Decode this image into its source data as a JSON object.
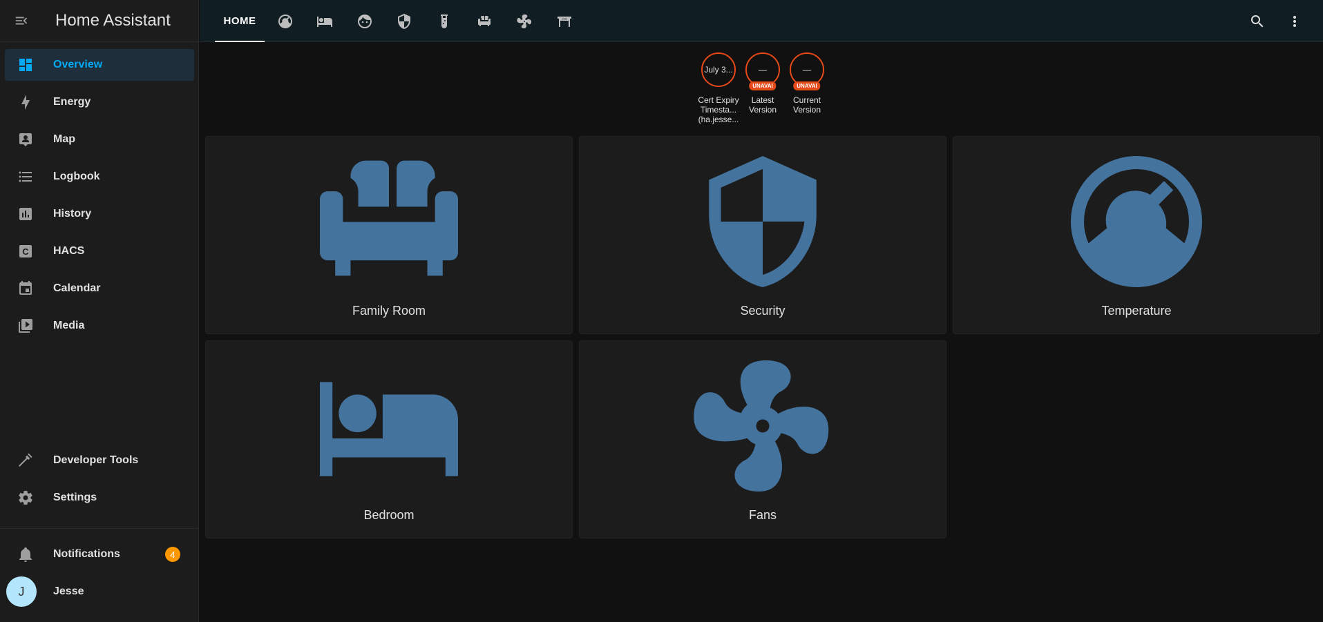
{
  "app": {
    "title": "Home Assistant"
  },
  "sidebar": {
    "items": [
      {
        "label": "Overview",
        "icon": "view-dashboard-icon",
        "active": true
      },
      {
        "label": "Energy",
        "icon": "lightning-bolt-icon"
      },
      {
        "label": "Map",
        "icon": "map-account-icon"
      },
      {
        "label": "Logbook",
        "icon": "format-list-bulleted-icon"
      },
      {
        "label": "History",
        "icon": "chart-box-icon"
      },
      {
        "label": "HACS",
        "icon": "hacs-icon"
      },
      {
        "label": "Calendar",
        "icon": "calendar-icon"
      },
      {
        "label": "Media",
        "icon": "play-box-multiple-icon"
      }
    ],
    "bottom": [
      {
        "label": "Developer Tools",
        "icon": "hammer-icon"
      },
      {
        "label": "Settings",
        "icon": "cog-icon"
      }
    ],
    "notifications": {
      "label": "Notifications",
      "count": "4"
    },
    "user": {
      "name": "Jesse",
      "initial": "J"
    }
  },
  "topbar": {
    "home_tab": "HOME",
    "icon_tabs": [
      "gauge-icon",
      "bed-icon",
      "face-icon",
      "shield-icon",
      "test-tube-icon",
      "sofa-icon",
      "fan-icon",
      "table-furniture-icon"
    ]
  },
  "badges": [
    {
      "value": "July 3...",
      "name": "Cert Expiry Timesta... (ha.jesse...",
      "pill": ""
    },
    {
      "value": "—",
      "name": "Latest Version",
      "pill": "UNAVAI"
    },
    {
      "value": "—",
      "name": "Current Version",
      "pill": "UNAVAI"
    }
  ],
  "cards": [
    {
      "name": "Family Room",
      "icon": "sofa-icon"
    },
    {
      "name": "Security",
      "icon": "shield-half-icon"
    },
    {
      "name": "Temperature",
      "icon": "gauge-icon"
    },
    {
      "name": "Bedroom",
      "icon": "bed-icon"
    },
    {
      "name": "Fans",
      "icon": "fan-icon"
    }
  ],
  "colors": {
    "accent": "#03a9f4",
    "card_icon": "#44739e",
    "badge_border": "#e64a19",
    "notification_badge": "#ff9800"
  }
}
